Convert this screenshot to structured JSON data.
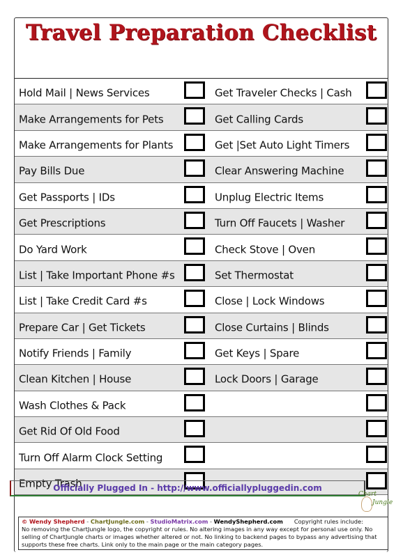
{
  "title": "Travel Preparation Checklist",
  "colors": {
    "title": "#b0141c",
    "row_shade": "#e6e6e6",
    "link": "#5a3aa8"
  },
  "checklist": {
    "left": [
      {
        "label": "Hold Mail | News Services",
        "checked": false
      },
      {
        "label": "Make Arrangements for Pets",
        "checked": false
      },
      {
        "label": "Make Arrangements for Plants",
        "checked": false
      },
      {
        "label": "Pay Bills Due",
        "checked": false
      },
      {
        "label": "Get Passports | IDs",
        "checked": false
      },
      {
        "label": "Get Prescriptions",
        "checked": false
      },
      {
        "label": "Do Yard Work",
        "checked": false
      },
      {
        "label": "List | Take Important Phone #s",
        "checked": false
      },
      {
        "label": "List | Take Credit Card #s",
        "checked": false
      },
      {
        "label": "Prepare Car | Get Tickets",
        "checked": false
      },
      {
        "label": "Notify Friends | Family",
        "checked": false
      },
      {
        "label": "Clean Kitchen | House",
        "checked": false
      },
      {
        "label": "Wash Clothes & Pack",
        "checked": false
      },
      {
        "label": "Get Rid Of Old Food",
        "checked": false
      },
      {
        "label": "Turn Off Alarm Clock Setting",
        "checked": false
      },
      {
        "label": "Empty Trash",
        "checked": false
      }
    ],
    "right": [
      {
        "label": "Get Traveler Checks | Cash",
        "checked": false
      },
      {
        "label": "Get Calling Cards",
        "checked": false
      },
      {
        "label": "Get |Set Auto Light Timers",
        "checked": false
      },
      {
        "label": "Clear Answering Machine",
        "checked": false
      },
      {
        "label": "Unplug Electric Items",
        "checked": false
      },
      {
        "label": "Turn Off Faucets | Washer",
        "checked": false
      },
      {
        "label": "Check Stove | Oven",
        "checked": false
      },
      {
        "label": "Set Thermostat",
        "checked": false
      },
      {
        "label": "Close | Lock Windows",
        "checked": false
      },
      {
        "label": "Close Curtains | Blinds",
        "checked": false
      },
      {
        "label": "Get Keys | Spare",
        "checked": false
      },
      {
        "label": "Lock Doors | Garage",
        "checked": false
      },
      {
        "label": "",
        "checked": false
      },
      {
        "label": "",
        "checked": false
      },
      {
        "label": "",
        "checked": false
      },
      {
        "label": "",
        "checked": false
      }
    ]
  },
  "link_banner": "Officially Plugged In - http://www.officiallypluggedin.com",
  "logo": {
    "line1": "Chart",
    "line2": "Jungle"
  },
  "footer": {
    "copyright_symbol": "©",
    "author": "Wendy Shepherd",
    "sep": " - ",
    "site1": "ChartJungle.com",
    "site2": "StudioMatrix.com",
    "site3": "WendyShepherd.com",
    "rules_heading": "Copyright rules include:",
    "rules_text": "No removing the ChartJungle logo, the copyright or rules. No altering images in any way except for personal use only. No selling of ChartJungle charts or images whether altered or not. No linking to backend pages to bypass any advertising that supports these free charts. Link only to the main page or the main category pages."
  }
}
